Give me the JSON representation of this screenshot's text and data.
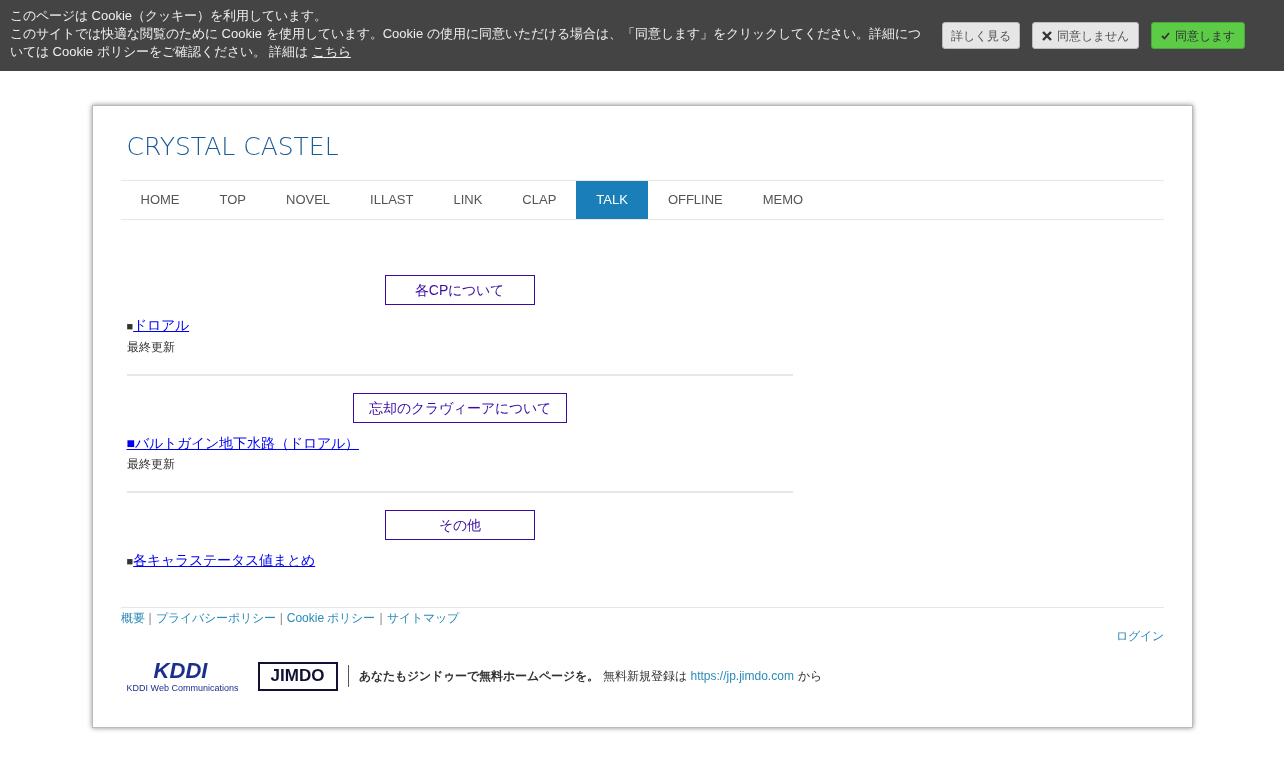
{
  "cookie_banner": {
    "title": "このページは Cookie（クッキー）を利用しています。",
    "message": "このサイトでは快適な閲覧のために Cookie を使用しています。Cookie の使用に同意いただける場合は、「同意します」をクリックしてください。詳細については Cookie ポリシーをご確認ください。 詳細は",
    "link": "こちら",
    "buttons": [
      {
        "label": "詳しく見る",
        "kind": "plain"
      },
      {
        "label": "同意しません",
        "kind": "decline"
      },
      {
        "label": "同意します",
        "kind": "accept"
      }
    ]
  },
  "site_title": "CRYSTAL CASTEL",
  "nav": [
    {
      "label": "HOME",
      "selected": false
    },
    {
      "label": "TOP",
      "selected": false
    },
    {
      "label": "NOVEL",
      "selected": false
    },
    {
      "label": "ILLAST",
      "selected": false
    },
    {
      "label": "LINK",
      "selected": false
    },
    {
      "label": "CLAP",
      "selected": false
    },
    {
      "label": "TALK",
      "selected": true
    },
    {
      "label": "OFFLINE",
      "selected": false
    },
    {
      "label": "MEMO",
      "selected": false
    }
  ],
  "sections": [
    {
      "heading": "各CPについて",
      "bullet": "■",
      "link": "ドロアル",
      "bullet_linked": false,
      "note": "最終更新"
    },
    {
      "heading": "忘却のクラヴィーアについて",
      "bullet": "■",
      "link": "バルトガイン地下水路（ドロアル）",
      "bullet_linked": true,
      "note": "最終更新"
    },
    {
      "heading": "その他",
      "bullet": "■",
      "link": "各キャラステータス値まとめ",
      "bullet_linked": false
    }
  ],
  "footer": {
    "links": [
      "概要",
      "プライバシーポリシー",
      "Cookie ポリシー",
      "サイトマップ"
    ],
    "separator": "|",
    "login": "ログイン",
    "kddi_logo": "KDDI",
    "kddi_caption": "KDDI Web Communications",
    "jimdo_logo": "JIMDO",
    "promo_bold": "あなたもジンドゥーで無料ホームページを。",
    "promo": "無料新規登録は",
    "promo_link": "https://jp.jimdo.com",
    "promo_tail": "から"
  }
}
